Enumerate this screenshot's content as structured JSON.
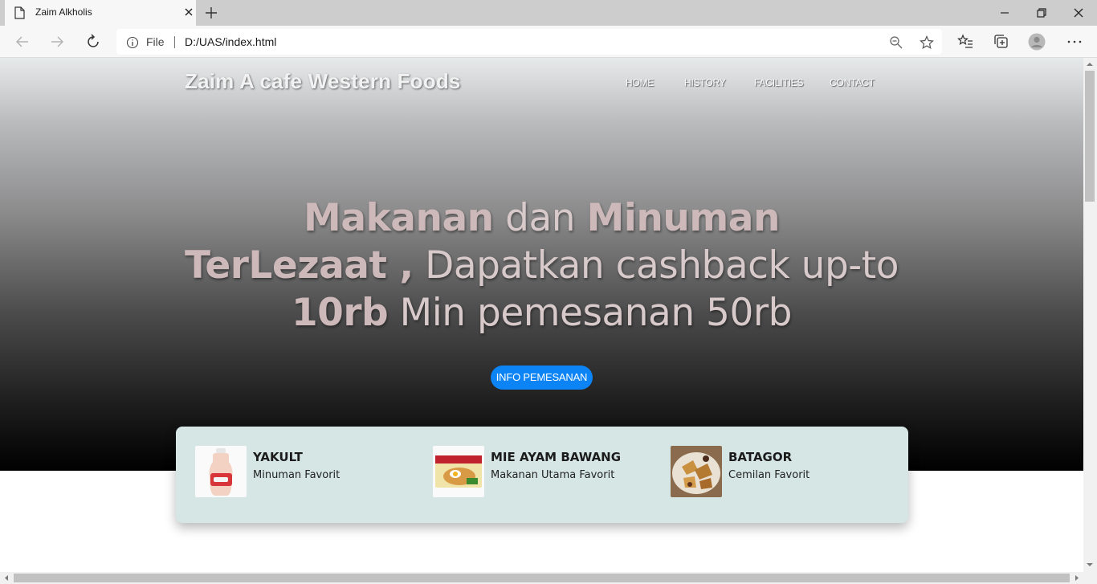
{
  "browser": {
    "tab_title": "Zaim Alkholis",
    "file_label": "File",
    "url": "D:/UAS/index.html"
  },
  "site": {
    "brand": "Zaim A cafe Western Foods",
    "nav": [
      "HOME",
      "HISTORY",
      "FACILITIES",
      "CONTACT"
    ],
    "headline": {
      "line1_bold_a": "Makanan",
      "line1_light": "dan",
      "line1_bold_b": "Minuman",
      "line2_bold": "TerLezaat ,",
      "line2_light": "Dapatkan cashback up-to",
      "line3_bold": "10rb",
      "line3_light": "Min pemesanan 50rb"
    },
    "cta_label": "INFO PEMESANAN",
    "accent_color": "#0d84f5",
    "card_color": "#d5e6e4",
    "items": [
      {
        "title": "YAKULT",
        "subtitle": "Minuman Favorit"
      },
      {
        "title": "MIE AYAM BAWANG",
        "subtitle": "Makanan Utama Favorit"
      },
      {
        "title": "BATAGOR",
        "subtitle": "Cemilan Favorit"
      }
    ]
  }
}
